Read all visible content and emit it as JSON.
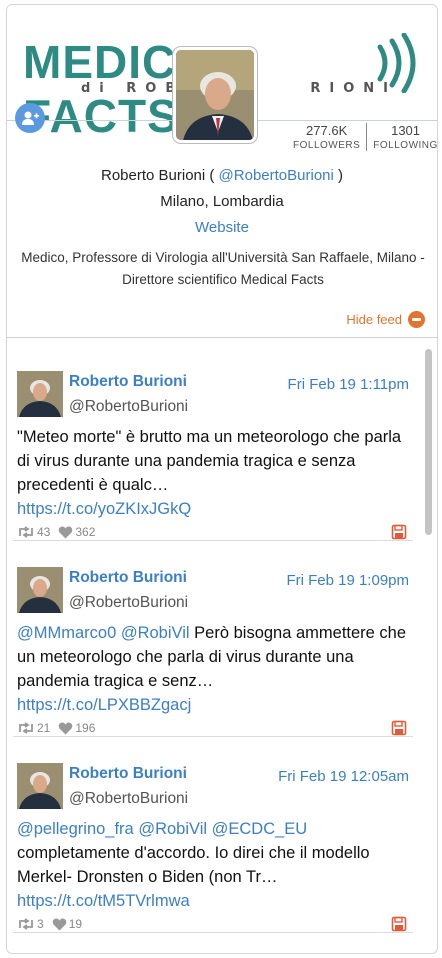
{
  "banner": {
    "logo_left": "MEDIC",
    "logo_right": "FACTS",
    "logo_sub": "di ROBE        RIONI"
  },
  "profile": {
    "followers_count": "277.6K",
    "followers_label": "FOLLOWERS",
    "following_count": "1301",
    "following_label": "FOLLOWING",
    "name_prefix": "Roberto Burioni ( ",
    "handle": "@RobertoBurioni",
    "name_suffix": " )",
    "location": "Milano, Lombardia",
    "website": "Website",
    "bio": "Medico, Professore di Virologia all'Università San Raffaele, Milano - Direttore scientifico Medical Facts"
  },
  "hide_feed_label": "Hide feed",
  "tweets": [
    {
      "name": "Roberto Burioni",
      "handle": "@RobertoBurioni",
      "date": "Fri Feb 19 1:11pm",
      "mentions": "",
      "text": "\"Meteo morte\" è brutto ma un meteorologo che parla di virus durante una pandemia tragica e senza precedenti è qualc…",
      "link": "https://t.co/yoZKIxJGkQ",
      "retweets": "43",
      "likes": "362"
    },
    {
      "name": "Roberto Burioni",
      "handle": "@RobertoBurioni",
      "date": "Fri Feb 19 1:09pm",
      "mentions": "@MMmarco0 @RobiVil",
      "text": " Però bisogna ammettere che un meteorologo che parla di virus durante una pandemia tragica e senz…",
      "link": "https://t.co/LPXBBZgacj",
      "retweets": "21",
      "likes": "196"
    },
    {
      "name": "Roberto Burioni",
      "handle": "@RobertoBurioni",
      "date": "Fri Feb 19 12:05am",
      "mentions": "@pellegrino_fra @RobiVil @ECDC_EU",
      "text": " completamente d'accordo. Io direi che il modello Merkel- Dronsten o Biden (non Tr…",
      "link": "https://t.co/tM5TVrlmwa",
      "retweets": "3",
      "likes": "19"
    }
  ],
  "colors": {
    "link_blue": "#3b7fc4",
    "accent_orange": "#e2742f",
    "save_red": "#e05a3a",
    "logo_teal": "#2e8b83"
  }
}
